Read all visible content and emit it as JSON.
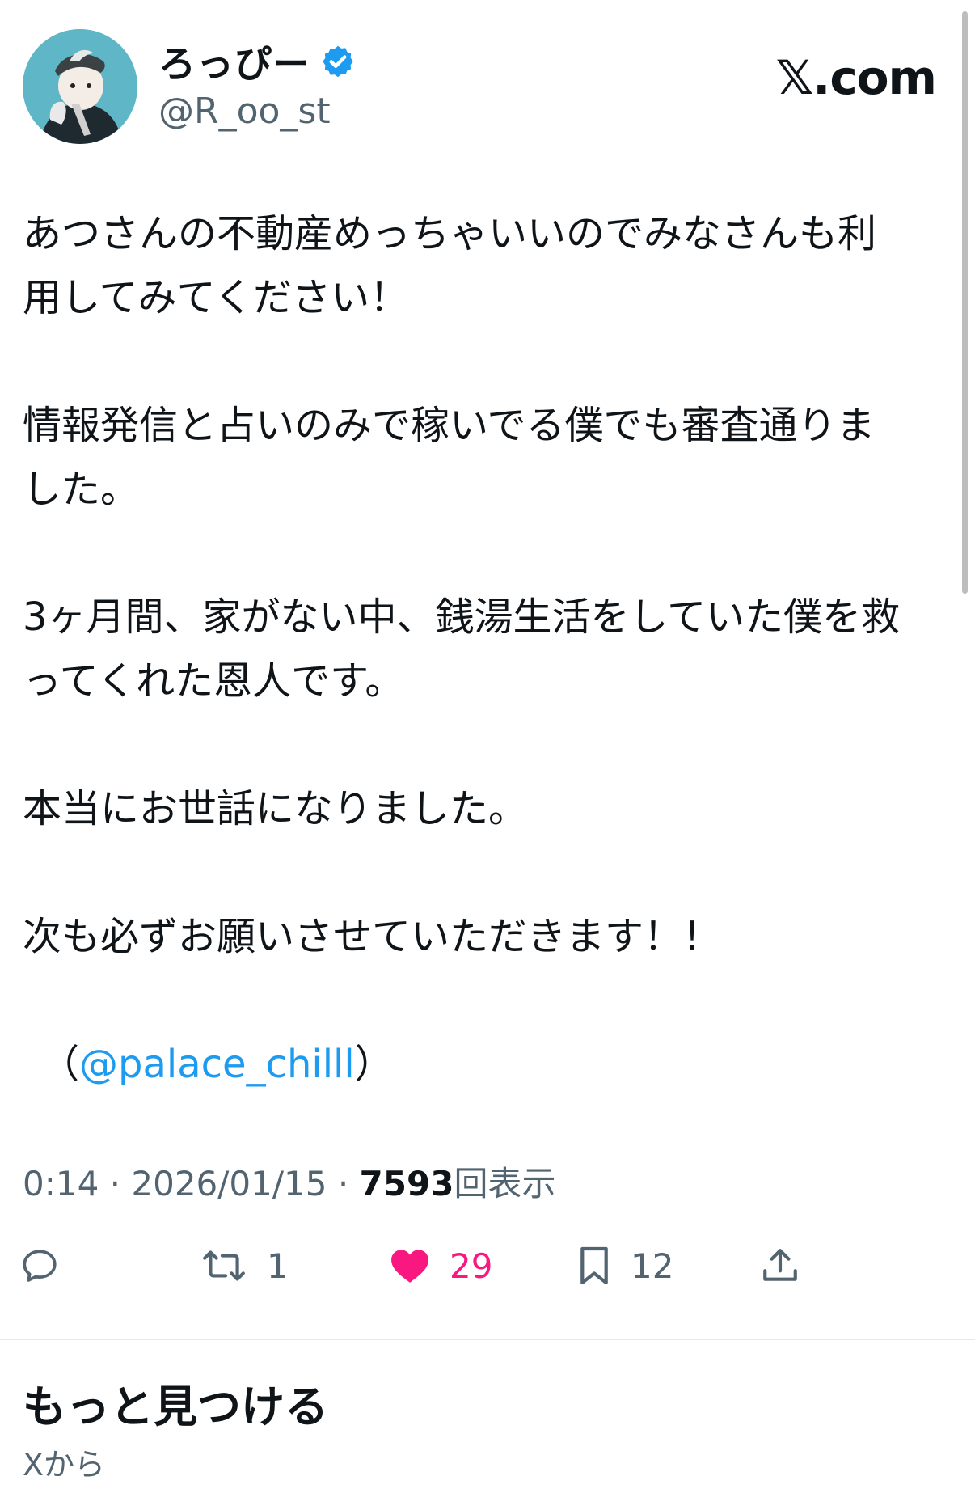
{
  "user": {
    "display_name": "ろっぴー",
    "handle": "@R_oo_st",
    "verified": true
  },
  "brand": "𝕏.com",
  "tweet": {
    "paragraphs": [
      "あつさんの不動産めっちゃいいのでみなさんも利\n用してみてください！",
      "情報発信と占いのみで稼いでる僕でも審査通りま\nした。",
      "3ヶ月間、家がない中、銭湯生活をしていた僕を救\nってくれた恩人です。",
      "本当にお世話になりました。",
      "次も必ずお願いさせていただきます！！"
    ],
    "mention_open": "（",
    "mention": "@palace_chilll",
    "mention_close": "）"
  },
  "meta": {
    "time": "0:14",
    "sep1": " · ",
    "date": "2026/01/15",
    "sep2": " · ",
    "views": "7593",
    "views_label": "回表示"
  },
  "actions": {
    "reply_icon": "reply-icon",
    "retweet_icon": "retweet-icon",
    "retweet_count": "1",
    "like_icon": "heart-icon",
    "like_count": "29",
    "bookmark_icon": "bookmark-icon",
    "bookmark_count": "12",
    "share_icon": "share-icon"
  },
  "more": {
    "title": "もっと見つける",
    "subtitle": "Xから"
  },
  "colors": {
    "accent": "#1d9bf0",
    "like": "#f91880",
    "muted": "#536471",
    "text": "#0f1419"
  }
}
